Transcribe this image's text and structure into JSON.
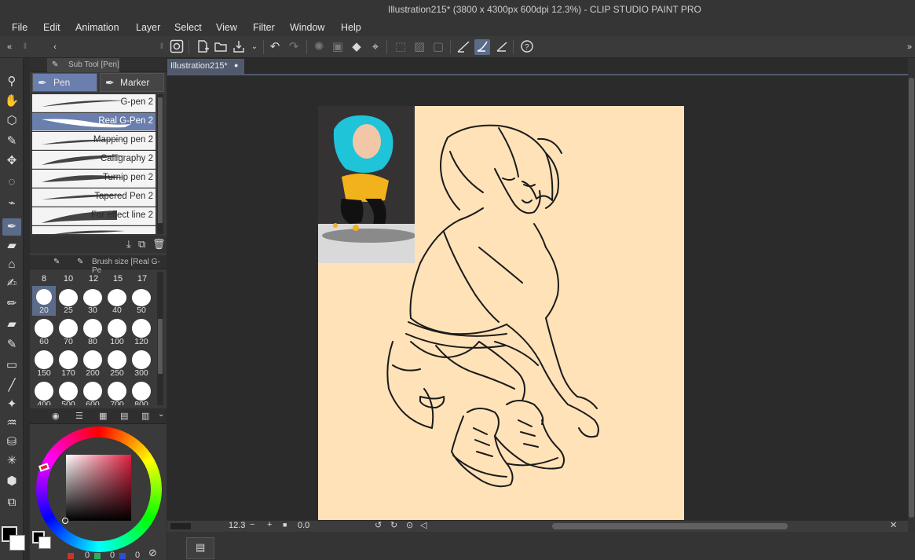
{
  "window": {
    "title": "Illustration215* (3800 x 4300px 600dpi 12.3%)  - CLIP STUDIO PAINT PRO"
  },
  "menu": [
    "File",
    "Edit",
    "Animation",
    "Layer",
    "Select",
    "View",
    "Filter",
    "Window",
    "Help"
  ],
  "document_tab": {
    "label": "Illustration215*",
    "close": "●"
  },
  "subtool_panel": {
    "tab_label": "Sub Tool [Pen]",
    "groups": [
      {
        "label": "Pen",
        "selected": true
      },
      {
        "label": "Marker",
        "selected": false
      }
    ],
    "brushes": [
      {
        "label": "G-pen 2",
        "selected": false
      },
      {
        "label": "Real G-Pen 2",
        "selected": true
      },
      {
        "label": "Mapping pen 2",
        "selected": false
      },
      {
        "label": "Calligraphy 2",
        "selected": false
      },
      {
        "label": "Turnip pen 2",
        "selected": false
      },
      {
        "label": "Tapered Pen 2",
        "selected": false
      },
      {
        "label": "For effect line 2",
        "selected": false
      }
    ]
  },
  "brush_size_panel": {
    "tab_label": "Brush size [Real G-Pe",
    "top_row": [
      "8",
      "10",
      "12",
      "15",
      "17"
    ],
    "rows": [
      [
        "20",
        "25",
        "30",
        "40",
        "50"
      ],
      [
        "60",
        "70",
        "80",
        "100",
        "120"
      ],
      [
        "150",
        "170",
        "200",
        "250",
        "300"
      ],
      [
        "400",
        "500",
        "600",
        "700",
        "800"
      ]
    ],
    "selected": "20"
  },
  "color_panel": {
    "values": [
      "0",
      "0",
      "0"
    ],
    "accent_colors": {
      "red_channel": "#c0392b",
      "green_channel": "#27ae60",
      "blue_channel": "#2e4fd1"
    }
  },
  "status": {
    "zoom": "12.3",
    "rotation": "0.0"
  },
  "colors": {
    "paper": "#ffe2b8",
    "selection": "#5b6b8a",
    "ui_dark": "#2d2d2d"
  }
}
